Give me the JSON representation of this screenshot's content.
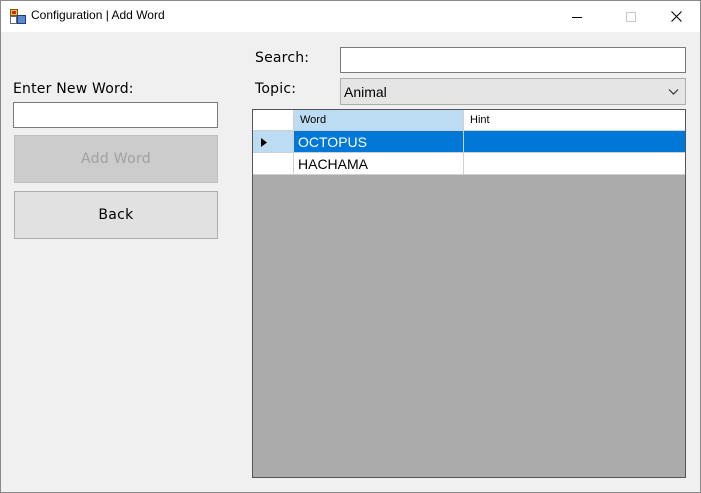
{
  "window": {
    "title": "Configuration | Add Word"
  },
  "left_panel": {
    "new_word_label": "Enter New Word:",
    "new_word_value": "",
    "add_word_button": "Add Word",
    "back_button": "Back"
  },
  "search": {
    "label": "Search:",
    "value": ""
  },
  "topic": {
    "label": "Topic:",
    "selected": "Animal"
  },
  "grid": {
    "columns": [
      "Word",
      "Hint"
    ],
    "rows": [
      {
        "word": "OCTOPUS",
        "hint": "",
        "selected": true
      },
      {
        "word": "HACHAMA",
        "hint": "",
        "selected": false
      }
    ]
  },
  "colors": {
    "selection": "#0078d7",
    "grid_background": "#ababab",
    "header_selected": "#bcdcf4"
  }
}
